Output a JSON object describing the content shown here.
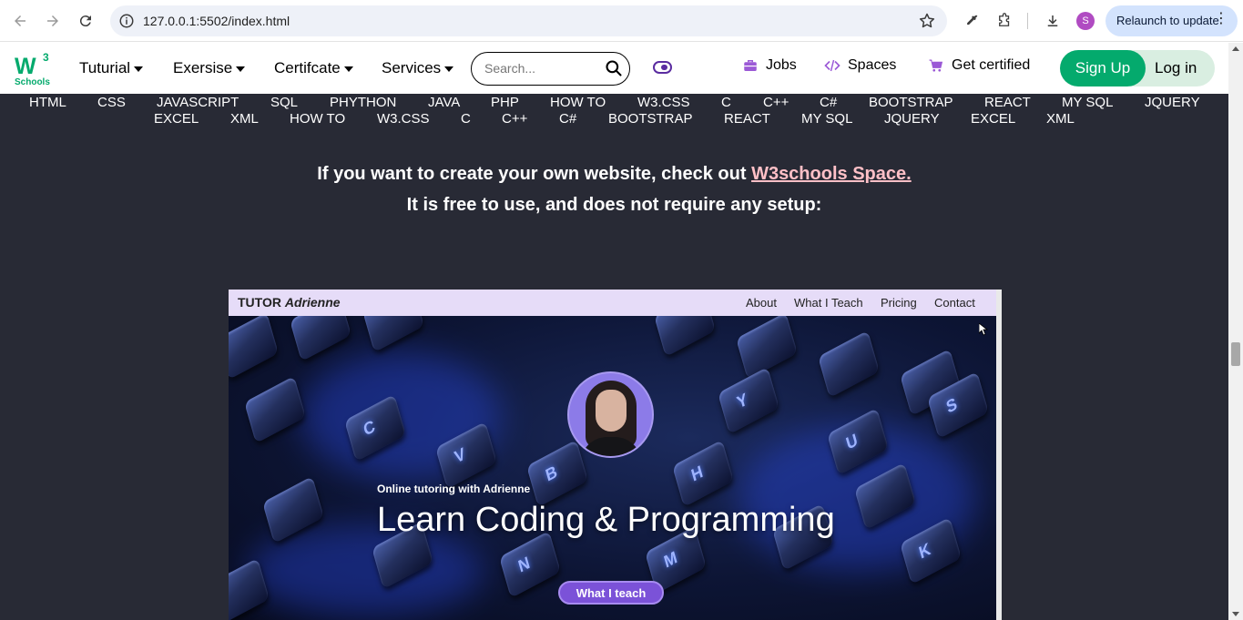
{
  "browser": {
    "url": "127.0.0.1:5502/index.html",
    "relaunch_label": "Relaunch to update",
    "profile_initial": "S",
    "icons": [
      "back-icon",
      "forward-icon",
      "reload-icon",
      "site-info-icon",
      "bookmark-star-icon",
      "eyedropper-icon",
      "extensions-icon",
      "download-icon",
      "menu-dots-icon"
    ]
  },
  "header": {
    "logo_main": "W",
    "logo_sup": "3",
    "logo_sub": "Schools",
    "menus": [
      {
        "label": "Tuturial"
      },
      {
        "label": "Exersise"
      },
      {
        "label": "Certifcate"
      },
      {
        "label": "Services"
      }
    ],
    "search_placeholder": "Search...",
    "links": {
      "jobs": "Jobs",
      "spaces": "Spaces",
      "certified": "Get certified"
    },
    "signup": "Sign Up",
    "login": "Log in",
    "brand_color": "#04aa6d"
  },
  "topics": {
    "row1": [
      "HTML",
      "CSS",
      "JAVASCRIPT",
      "SQL",
      "PHYTHON",
      "JAVA",
      "PHP",
      "HOW TO",
      "W3.CSS",
      "C",
      "C++",
      "C#",
      "BOOTSTRAP",
      "REACT",
      "MY SQL",
      "JQUERY"
    ],
    "row2": [
      "EXCEL",
      "XML",
      "HOW TO",
      "W3.CSS",
      "C",
      "C++",
      "C#",
      "BOOTSTRAP",
      "REACT",
      "MY SQL",
      "JQUERY",
      "EXCEL",
      "XML"
    ]
  },
  "promo": {
    "line1_before": "If you want to create your own website, check out ",
    "line1_link": "W3schools Space.",
    "line2": "It is free to use, and does not require any setup:"
  },
  "tutor": {
    "brand": "TUTOR",
    "brand_name": "Adrienne",
    "nav": [
      "About",
      "What I Teach",
      "Pricing",
      "Contact"
    ],
    "subtitle": "Online tutoring with Adrienne",
    "headline": "Learn Coding & Programming",
    "cta": "What I teach",
    "key_letters": [
      "C",
      "V",
      "B",
      "H",
      "U",
      "Y",
      "S",
      "N",
      "M",
      "K"
    ]
  }
}
